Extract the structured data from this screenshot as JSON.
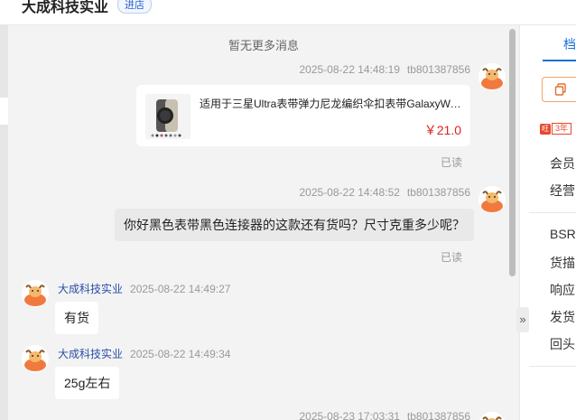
{
  "header": {
    "shop_name": "大成科技实业",
    "badge": "进店"
  },
  "chat": {
    "no_more": "暂无更多消息",
    "messages": [
      {
        "time": "2025-08-22 14:48:19",
        "user": "tb801387856",
        "type": "product",
        "product": {
          "title": "适用于三星Ultra表带弹力尼龙编织伞扣表带GalaxyWa...",
          "price": "￥21.0"
        },
        "status": "已读"
      },
      {
        "time": "2025-08-22 14:48:52",
        "user": "tb801387856",
        "type": "text",
        "text": "你好黑色表带黑色连接器的这款还有货吗？尺寸克重多少呢？",
        "status": "已读"
      },
      {
        "sender": "大成科技实业",
        "time": "2025-08-22 14:49:27",
        "type": "text",
        "text": "有货"
      },
      {
        "sender": "大成科技实业",
        "time": "2025-08-22 14:49:34",
        "type": "text",
        "text": "25g左右"
      },
      {
        "time": "2025-08-23 17:03:31",
        "user": "tb801387856"
      }
    ]
  },
  "right_panel": {
    "tab": "档",
    "years": "3年",
    "year_icon": "旺",
    "labels": [
      "会员",
      "经营",
      "BSR",
      "货描",
      "响应",
      "发货",
      "回头"
    ]
  },
  "icons": {
    "expand": "»",
    "copy": "copy-icon",
    "avatar": "cow-avatar-icon"
  },
  "colors": {
    "accent": "#1a6fd8",
    "price": "#e02020",
    "sender": "#2a4fa8"
  }
}
